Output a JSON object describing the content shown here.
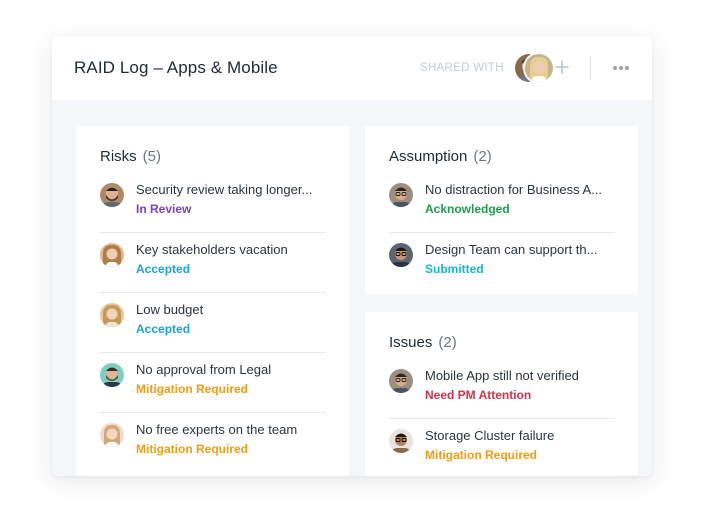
{
  "header": {
    "title": "RAID Log – Apps & Mobile",
    "shared_label": "SHARED WITH",
    "shared_avatars": [
      "avatar-man-beard",
      "avatar-woman-blonde"
    ]
  },
  "colors": {
    "in_review": "#7b3fd1",
    "accepted": "#1ba1e2",
    "mitigation_required": "#f39c12",
    "acknowledged": "#1e9e4a",
    "submitted": "#15b7d6",
    "need_pm_attention": "#d9304a"
  },
  "risks": {
    "title": "Risks",
    "count": "(5)",
    "items": [
      {
        "name": "Security review taking longer...",
        "status": "In Review",
        "color": "#7b3fd1",
        "avatar": "avatar-man-beard-1"
      },
      {
        "name": "Key stakeholders vacation",
        "status": "Accepted",
        "color": "#1ba1e2",
        "avatar": "avatar-woman-1"
      },
      {
        "name": "Low budget",
        "status": "Accepted",
        "color": "#1ba1e2",
        "avatar": "avatar-woman-2"
      },
      {
        "name": "No approval from Legal",
        "status": "Mitigation Required",
        "color": "#f39c12",
        "avatar": "avatar-man-beard-2"
      },
      {
        "name": "No free experts on the team",
        "status": "Mitigation Required",
        "color": "#f39c12",
        "avatar": "avatar-woman-3"
      }
    ]
  },
  "assumption": {
    "title": "Assumption",
    "count": "(2)",
    "items": [
      {
        "name": "No distraction for Business A...",
        "status": "Acknowledged",
        "color": "#1e9e4a",
        "avatar": "avatar-man-glasses-1"
      },
      {
        "name": "Design Team can support th...",
        "status": "Submitted",
        "color": "#15b7d6",
        "avatar": "avatar-man-glasses-2"
      }
    ]
  },
  "issues": {
    "title": "Issues",
    "count": "(2)",
    "items": [
      {
        "name": "Mobile App still not verified",
        "status": "Need PM Attention",
        "color": "#d9304a",
        "avatar": "avatar-man-glasses-3"
      },
      {
        "name": "Storage Cluster failure",
        "status": "Mitigation Required",
        "color": "#f39c12",
        "avatar": "avatar-man-glasses-4"
      }
    ]
  }
}
